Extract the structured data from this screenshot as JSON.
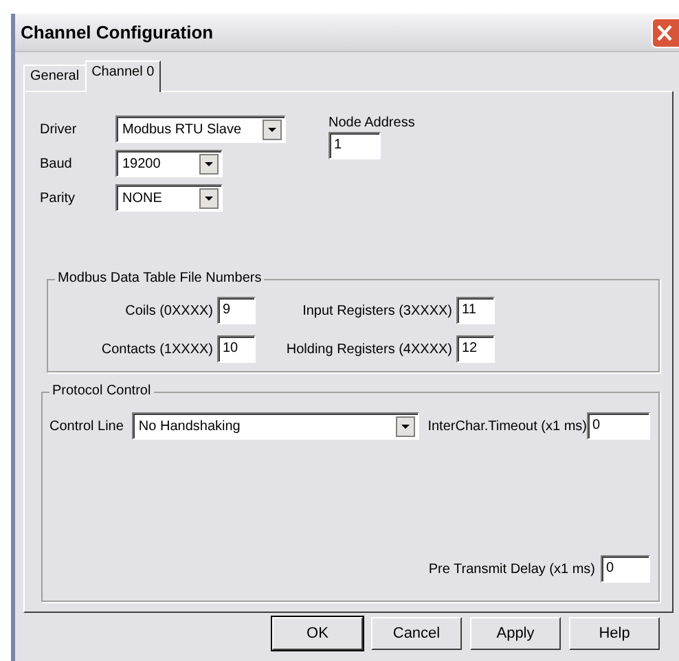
{
  "window": {
    "title": "Channel Configuration"
  },
  "tabs": [
    {
      "label": "General",
      "selected": false
    },
    {
      "label": "Channel 0",
      "selected": true
    }
  ],
  "settings": [
    {
      "label": "Driver",
      "value": "Modbus RTU Slave"
    },
    {
      "label": "Baud",
      "value": "19200"
    },
    {
      "label": "Parity",
      "value": "NONE"
    }
  ],
  "node_address": {
    "label": "Node Address",
    "value": "1"
  },
  "modbus_data_table": {
    "title": "Modbus Data Table File Numbers",
    "fields": [
      {
        "label": "Coils (0XXXX)",
        "value": "9"
      },
      {
        "label": "Input Registers (3XXXX)",
        "value": "11"
      },
      {
        "label": "Contacts (1XXXX)",
        "value": "10"
      },
      {
        "label": "Holding Registers (4XXXX)",
        "value": "12"
      }
    ]
  },
  "protocol_control": {
    "title": "Protocol Control",
    "control_line": {
      "label": "Control Line",
      "value": "No Handshaking"
    },
    "interchar_timeout": {
      "label": "InterChar.Timeout (x1 ms)",
      "value": "0"
    },
    "pre_transmit_delay": {
      "label": "Pre Transmit Delay (x1 ms)",
      "value": "0"
    }
  },
  "buttons": [
    {
      "label": "OK",
      "default": true
    },
    {
      "label": "Cancel",
      "default": false
    },
    {
      "label": "Apply",
      "default": false
    },
    {
      "label": "Help",
      "default": false
    }
  ]
}
